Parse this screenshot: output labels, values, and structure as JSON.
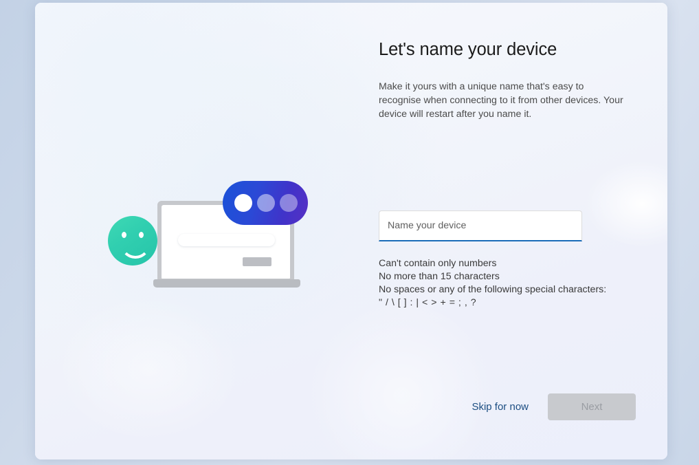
{
  "window": {
    "background_color": "#c9d6e8",
    "panel_color": "#f6f7fc"
  },
  "illustration": {
    "name": "device-naming-illustration",
    "laptop_frame_color": "#c6c8cc",
    "laptop_screen_color": "#ffffff",
    "pill_gradient_from": "#1a52d8",
    "pill_gradient_to": "#5730c4",
    "smiley_gradient_from": "#3fd9b4",
    "smiley_gradient_to": "#26c4a9"
  },
  "main": {
    "title": "Let's name your device",
    "description": "Make it yours with a unique name that's easy to recognise when connecting to it from other devices. Your device will restart after you name it."
  },
  "input": {
    "placeholder": "Name your device",
    "value": "",
    "focused": true,
    "focus_underline_color": "#1a6cb8"
  },
  "validation": {
    "rules": [
      "Can't contain only numbers",
      "No more than 15 characters",
      "No spaces or any of the following special characters:",
      "\" / \\ [ ] : | < > + = ; , ?"
    ]
  },
  "footer": {
    "skip_label": "Skip for now",
    "skip_color": "#1c4e82",
    "next_label": "Next",
    "next_enabled": false,
    "next_bg_color": "#c8cace",
    "next_text_color": "#9a9da3"
  }
}
